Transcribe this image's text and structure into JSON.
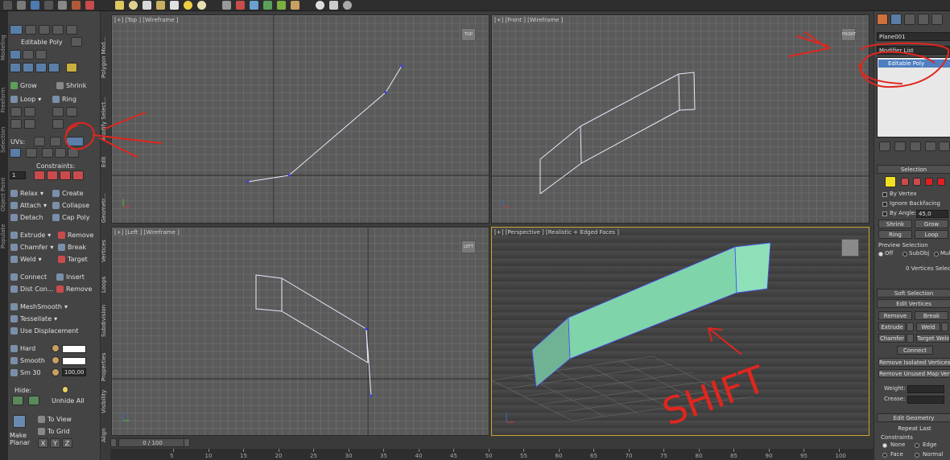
{
  "ribbon": {
    "panel_label": "Editable Poly",
    "grow": "Grow",
    "shrink": "Shrink",
    "loop": "Loop",
    "ring": "Ring",
    "uvs": "UVs:",
    "constraints": "Constraints:",
    "relax": "Relax",
    "create": "Create",
    "attach": "Attach",
    "collapse": "Collapse",
    "detach": "Detach",
    "cap_poly": "Cap Poly",
    "extrude": "Extrude",
    "remove": "Remove",
    "chamfer": "Chamfer",
    "break": "Break",
    "weld": "Weld",
    "target": "Target",
    "connect": "Connect",
    "insert": "Insert",
    "dist_con": "Dist Con...",
    "remove2": "Remove",
    "meshsmooth": "MeshSmooth",
    "tessellate": "Tessellate",
    "use_displacement": "Use Displacement",
    "hard": "Hard",
    "smooth": "Smooth",
    "sm30": "Sm 30",
    "sm_value": "100,00",
    "hide": "Hide:",
    "unhide_all": "Unhide All",
    "make_planar": "Make Planar",
    "to_view": "To View",
    "to_grid": "To Grid",
    "x": "X",
    "y": "Y",
    "z": "Z",
    "constraint_value": "1",
    "side_tabs": [
      "Modeling",
      "Freeform",
      "Selection",
      "Object Paint",
      "Populate"
    ],
    "panel_titles": [
      "Polygon Mod...",
      "Modify Select...",
      "Edit",
      "Geometr...",
      "Vertices",
      "Loops",
      "Subdivision",
      "Properties",
      "Visibility",
      "Align"
    ]
  },
  "viewports": {
    "top": {
      "label": "[+] [Top ] [Wireframe ]",
      "cube": "TOP"
    },
    "front": {
      "label": "[+] [Front ] [Wireframe ]",
      "cube": "FRONT"
    },
    "left": {
      "label": "[+] [Left ] [Wireframe ]",
      "cube": "LEFT"
    },
    "perspective": {
      "label": "[+] [Perspective ] [Realistic + Edged Faces ]"
    }
  },
  "timeline": {
    "slider": "0 / 100",
    "ticks": [
      "5",
      "10",
      "15",
      "20",
      "25",
      "30",
      "35",
      "40",
      "45",
      "50",
      "55",
      "60",
      "65",
      "70",
      "75",
      "80",
      "85",
      "90",
      "95",
      "100"
    ]
  },
  "command_panel": {
    "object_name": "Plane001",
    "modifier_list": "Modifier List",
    "stack_item": "Editable Poly",
    "selection_title": "Selection",
    "by_vertex": "By Vertex",
    "ignore_backfacing": "Ignore Backfacing",
    "by_angle": "By Angle:",
    "angle_value": "45,0",
    "shrink": "Shrink",
    "grow": "Grow",
    "ring": "Ring",
    "loop": "Loop",
    "preview_selection": "Preview Selection",
    "off": "Off",
    "subobj": "SubObj",
    "multi": "Multi",
    "vertices_selected": "0 Vertices Selected",
    "soft_selection": "Soft Selection",
    "edit_vertices": "Edit Vertices",
    "remove": "Remove",
    "break": "Break",
    "extrude": "Extrude",
    "weld": "Weld",
    "chamfer": "Chamfer",
    "target_weld": "Target Weld",
    "connect": "Connect",
    "remove_isolated": "Remove Isolated Vertices",
    "remove_unused": "Remove Unused Map Verts",
    "weight": "Weight:",
    "crease": "Crease:",
    "edit_geometry": "Edit Geometry",
    "repeat_last": "Repeat Last",
    "constraints": "Constraints",
    "none": "None",
    "edge": "Edge",
    "face": "Face",
    "normal": "Normal"
  },
  "annotation": {
    "text": "SHIFT",
    "color": "#e0261e"
  }
}
